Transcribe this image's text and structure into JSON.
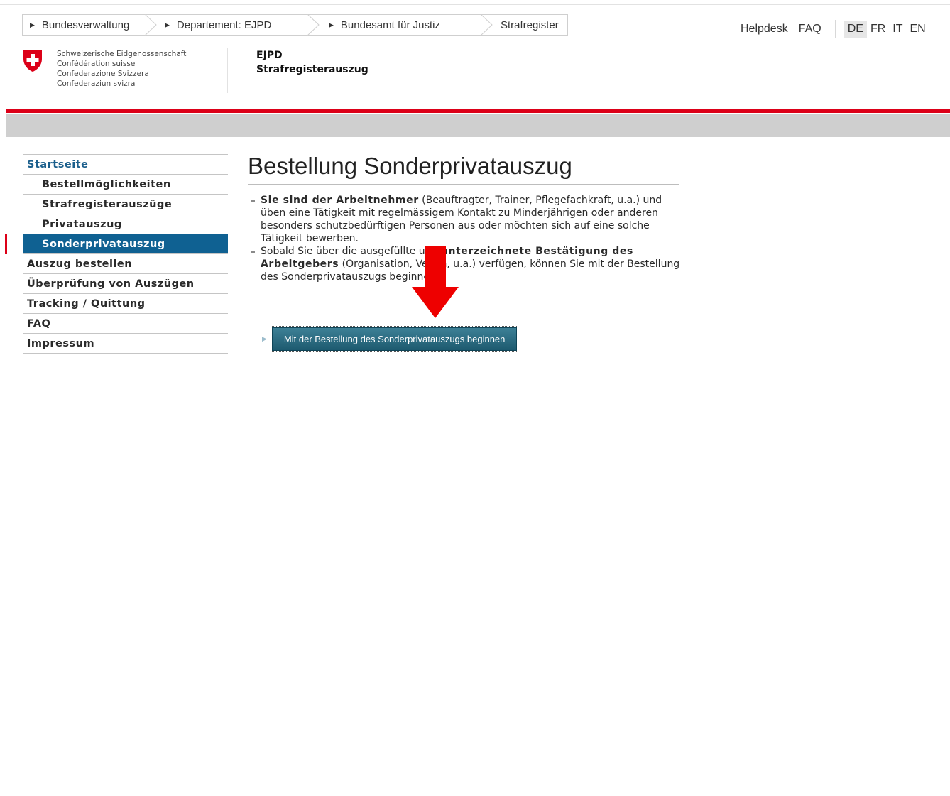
{
  "breadcrumb": {
    "items": [
      {
        "label": "Bundesverwaltung"
      },
      {
        "label": "Departement: EJPD"
      },
      {
        "label": "Bundesamt für Justiz"
      },
      {
        "label": "Strafregister"
      }
    ]
  },
  "header": {
    "helpdesk": "Helpdesk",
    "faq": "FAQ",
    "languages": [
      "DE",
      "FR",
      "IT",
      "EN"
    ],
    "active_language": "DE",
    "confederation": [
      "Schweizerische Eidgenossenschaft",
      "Confédération suisse",
      "Confederazione Svizzera",
      "Confederaziun svizra"
    ],
    "department": "EJPD",
    "application": "Strafregisterauszug"
  },
  "colors": {
    "accent_red": "#dc0018",
    "nav_active": "#0f6192",
    "button": "#2d6f86"
  },
  "nav": {
    "items": [
      {
        "label": "Startseite"
      },
      {
        "label": "Bestellmöglichkeiten"
      },
      {
        "label": "Strafregisterauszüge"
      },
      {
        "label": "Privatauszug"
      },
      {
        "label": "Sonderprivatauszug"
      },
      {
        "label": "Auszug bestellen"
      },
      {
        "label": "Überprüfung von Auszügen"
      },
      {
        "label": "Tracking / Quittung"
      },
      {
        "label": "FAQ"
      },
      {
        "label": "Impressum"
      }
    ]
  },
  "main": {
    "title": "Bestellung Sonderprivatauszug",
    "bullet1": {
      "bold": "Sie sind der Arbeitnehmer",
      "text": " (Beauftragter, Trainer, Pflegefachkraft, u.a.) und üben eine Tätigkeit mit regelmässigem Kontakt zu Minderjährigen oder anderen besonders schutzbedürftigen Personen aus oder möchten sich auf eine solche Tätigkeit bewerben."
    },
    "bullet2": {
      "text1": "Sobald Sie über die ausgefüllte und ",
      "bold": "unterzeichnete Bestätigung des Arbeitgebers",
      "text2": " (Organisation, Verein, u.a.) verfügen, können Sie mit der Bestellung des Sonderprivatauszugs beginnen."
    },
    "start_button": "Mit der Bestellung des Sonderprivatauszugs beginnen"
  }
}
